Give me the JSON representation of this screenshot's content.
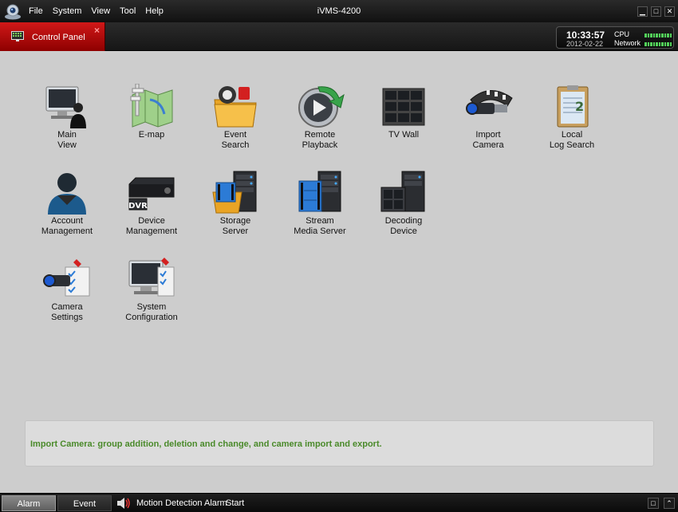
{
  "app": {
    "title": "iVMS-4200"
  },
  "menu": [
    "File",
    "System",
    "View",
    "Tool",
    "Help"
  ],
  "tab": {
    "label": "Control Panel",
    "close": "×"
  },
  "status": {
    "time": "10:33:57",
    "date": "2012-02-22",
    "cpu_label": "CPU",
    "network_label": "Network"
  },
  "tiles": [
    {
      "label": "Main\nView",
      "icon": "main-view-icon"
    },
    {
      "label": "E-map",
      "icon": "e-map-icon"
    },
    {
      "label": "Event\nSearch",
      "icon": "event-search-icon"
    },
    {
      "label": "Remote\nPlayback",
      "icon": "remote-playback-icon"
    },
    {
      "label": "TV Wall",
      "icon": "tv-wall-icon"
    },
    {
      "label": "Import\nCamera",
      "icon": "import-camera-icon"
    },
    {
      "label": "Local\nLog Search",
      "icon": "local-log-search-icon"
    },
    {
      "label": "Account\nManagement",
      "icon": "account-management-icon"
    },
    {
      "label": "Device\nManagement",
      "icon": "device-management-icon",
      "badge": "DVR"
    },
    {
      "label": "Storage\nServer",
      "icon": "storage-server-icon"
    },
    {
      "label": "Stream\nMedia Server",
      "icon": "stream-media-server-icon"
    },
    {
      "label": "Decoding\nDevice",
      "icon": "decoding-device-icon"
    },
    {
      "label": "Camera\nSettings",
      "icon": "camera-settings-icon"
    },
    {
      "label": "System\nConfiguration",
      "icon": "system-configuration-icon"
    }
  ],
  "info": {
    "text": "Import Camera: group addition, deletion and change, and camera import and export."
  },
  "bottom": {
    "alarm_tab": "Alarm",
    "event_tab": "Event",
    "alarm_type": "Motion Detection Alarm",
    "alarm_action": "Start"
  },
  "colors": {
    "accent_red": "#c81414",
    "info_green": "#4a8a2a",
    "meter_green": "#53d25a"
  }
}
